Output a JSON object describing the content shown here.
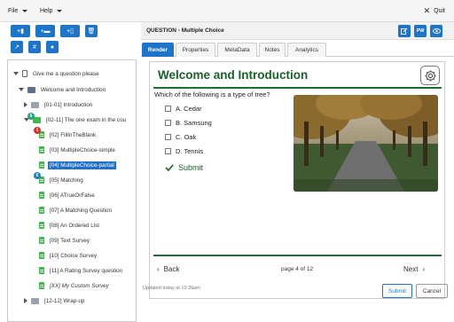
{
  "menubar": {
    "file": "File",
    "help": "Help",
    "quit": "Quit"
  },
  "toolbar": {
    "row1": [
      {
        "glyph": "+▮",
        "icon": "add-book-icon"
      },
      {
        "glyph": "+▬",
        "icon": "add-folder-icon"
      },
      {
        "glyph": "+▯",
        "icon": "add-page-icon"
      },
      {
        "glyph": "🗑",
        "icon": "trash-icon"
      }
    ],
    "row2": [
      {
        "glyph": "↗",
        "icon": "export-icon"
      },
      {
        "glyph": "#",
        "icon": "hash-icon"
      },
      {
        "glyph": "●",
        "icon": "chat-icon"
      }
    ]
  },
  "tree": {
    "items": [
      {
        "label": "Give me a question please",
        "icon": "device-icon",
        "twisty": "down"
      },
      {
        "label": "Welcome and Introduction",
        "icon": "book-icon",
        "twisty": "down"
      },
      {
        "label": "[01-01] Introduction",
        "icon": "folder-icon",
        "twisty": "right"
      },
      {
        "label": "[02-11] The one exam in the cou",
        "icon": "folder-green-icon",
        "twisty": "down",
        "badge": "6",
        "badge_color": "#1fa37d"
      },
      {
        "label": "[02] FillInTheBlank",
        "icon": "doc-icon",
        "badge": "1",
        "badge_color": "#d9302b"
      },
      {
        "label": "[03] MultipleChoice-simple",
        "icon": "doc-icon"
      },
      {
        "label": "[04] MultipleChoice-partial",
        "icon": "doc-icon",
        "selected": true
      },
      {
        "label": "[05] Matching",
        "icon": "doc-icon",
        "badge": "6",
        "badge_color": "#1f7fb8"
      },
      {
        "label": "[06] ATrueOrFalse",
        "icon": "doc-icon"
      },
      {
        "label": "[07] A Matching Question",
        "icon": "doc-icon"
      },
      {
        "label": "[08] An Ordered List",
        "icon": "doc-icon"
      },
      {
        "label": "[09] Text Survey",
        "icon": "doc-icon"
      },
      {
        "label": "[10] Choice Survey",
        "icon": "doc-icon"
      },
      {
        "label": "[11] A Rating Survey question",
        "icon": "doc-icon"
      },
      {
        "label": "[XX] My Custom Survey",
        "icon": "doc-icon",
        "italic": true
      },
      {
        "label": "[12-12] Wrap-up",
        "icon": "folder-icon",
        "twisty": "right"
      }
    ]
  },
  "header": {
    "title": "QUESTION - Multiple Choice",
    "btn_pw": "PW"
  },
  "tabs": [
    "Render",
    "Properties",
    "MetaData",
    "Notes",
    "Analytics"
  ],
  "render": {
    "title": "Welcome and Introduction",
    "prompt": "Which of the following is a type of tree?",
    "options": [
      "A. Cedar",
      "B. Samsung",
      "C. Oak",
      "D. Tennis"
    ],
    "submit": "Submit",
    "back": "Back",
    "next": "Next",
    "page": "page 4 of 12"
  },
  "footer": {
    "updated": "Updated today at 10:39am",
    "submit": "Submit",
    "cancel": "Cancel"
  },
  "colors": {
    "accent": "#1e74c9",
    "heading": "#17612a",
    "selected": "#1e6fc8"
  }
}
